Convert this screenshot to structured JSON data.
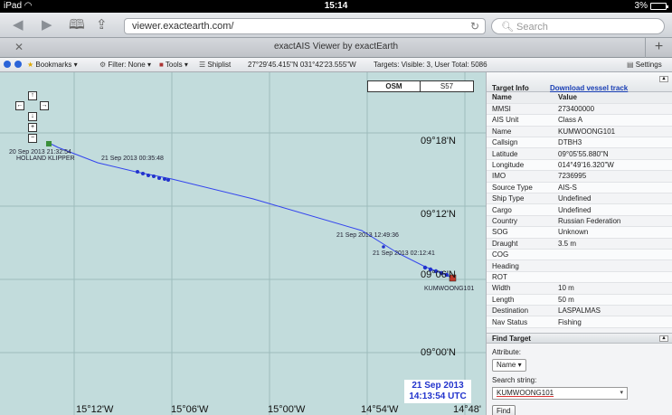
{
  "status_bar": {
    "device": "iPad",
    "time": "15:14",
    "battery": "3%"
  },
  "browser": {
    "url": "viewer.exactearth.com/",
    "search_placeholder": "Search",
    "tab_title": "exactAIS Viewer by exactEarth"
  },
  "toolbar": {
    "bookmarks": "Bookmarks ▾",
    "filter": "Filter: None ▾",
    "tools": "Tools ▾",
    "shiplist": "Shiplist",
    "coords": "27°29'45.415\"N 031°42'23.555\"W",
    "targets": "Targets: Visible: 3, User Total: 5086",
    "settings": "Settings"
  },
  "map": {
    "layers": [
      "OSM",
      "S57"
    ],
    "lat_labels": [
      "09°18'N",
      "09°12'N",
      "09°06'N",
      "09°00'N"
    ],
    "lon_labels": [
      "15°12'W",
      "15°06'W",
      "15°00'W",
      "14°54'W",
      "14°48'"
    ],
    "track_labels": [
      "20 Sep 2013 21:32:54",
      "21 Sep 2013 00:35:48",
      "21 Sep 2013 12:49:36",
      "21 Sep 2013 02:12:41"
    ],
    "vessels": [
      "HOLLAND KLIPPER",
      "KUMWOONG101"
    ],
    "date_line1": "21 Sep 2013",
    "date_line2": "14:13:54 UTC",
    "controls": {
      "up": "↑",
      "left": "←",
      "right": "→",
      "down": "↓",
      "zoom_in": "+",
      "zoom_out": "−"
    }
  },
  "target_info": {
    "title": "Target Info",
    "download_link": "Download vessel track",
    "headers": [
      "Name",
      "Value"
    ],
    "rows": [
      [
        "MMSI",
        "273400000"
      ],
      [
        "AIS Unit",
        "Class A"
      ],
      [
        "Name",
        "KUMWOONG101"
      ],
      [
        "Callsign",
        "DTBH3"
      ],
      [
        "Latitude",
        "09°05'55.880\"N"
      ],
      [
        "Longitude",
        "014°49'16.320\"W"
      ],
      [
        "IMO",
        "7236995"
      ],
      [
        "Source Type",
        "AIS-S"
      ],
      [
        "Ship Type",
        "Undefined"
      ],
      [
        "Cargo",
        "Undefined"
      ],
      [
        "Country",
        "Russian Federation"
      ],
      [
        "SOG",
        "Unknown"
      ],
      [
        "Draught",
        "3.5 m"
      ],
      [
        "COG",
        ""
      ],
      [
        "Heading",
        ""
      ],
      [
        "ROT",
        ""
      ],
      [
        "Width",
        "10 m"
      ],
      [
        "Length",
        "50 m"
      ],
      [
        "Destination",
        "LASPALMAS"
      ],
      [
        "Nav Status",
        "Fishing"
      ]
    ]
  },
  "find_target": {
    "title": "Find Target",
    "attribute_label": "Attribute:",
    "attribute_value": "Name",
    "search_label": "Search string:",
    "search_value": "KUMWOONG101",
    "button": "Find"
  },
  "colors": {
    "map_water": "#c2dcdc",
    "track": "#3344ee",
    "link": "#1a3fb5",
    "date_text": "#2233cc"
  }
}
